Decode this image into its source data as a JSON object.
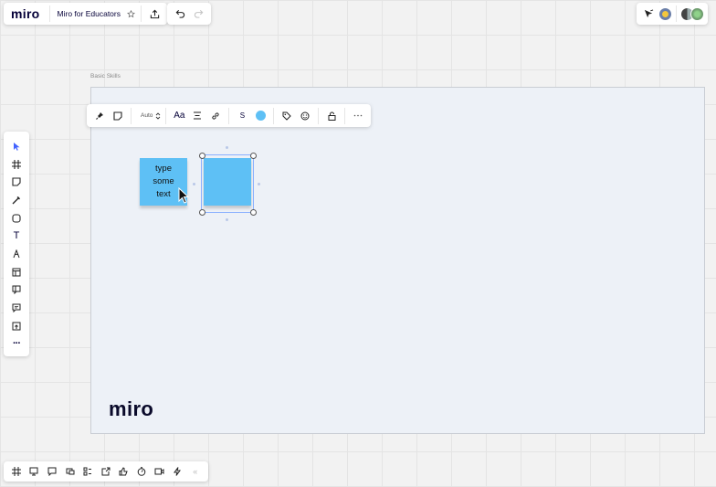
{
  "topbar": {
    "logo": "miro",
    "board_title": "Miro for Educators",
    "star_icon": "star-icon",
    "share_icon": "upload-icon"
  },
  "undo_redo": {
    "undo_icon": "undo-icon",
    "redo_icon": "redo-icon"
  },
  "right_panel": {
    "icons": [
      "cursor-share-icon",
      "avatar",
      "avatar",
      "avatar"
    ]
  },
  "frame": {
    "label": "Basic Skills",
    "logo_text": "miro",
    "background": "#edf1f7"
  },
  "context_toolbar": {
    "font_size_value": "Auto",
    "font_label": "Aa",
    "size_label": "S",
    "sticky_color": "#5ec0f5",
    "icons": [
      "pin-icon",
      "sticky-note-icon",
      "stepper-icon",
      "font-icon",
      "align-icon",
      "link-icon",
      "color-swatch-icon",
      "tag-icon",
      "emoji-icon",
      "lock-icon",
      "more-icon"
    ]
  },
  "sticky_notes": [
    {
      "text": "type some text",
      "color": "#5ec0f5"
    },
    {
      "text": "",
      "color": "#5ec0f5",
      "selected": true
    }
  ],
  "left_toolbar": {
    "tools": [
      "select-icon",
      "frame-icon",
      "sticky-note-icon",
      "pen-icon",
      "shape-icon",
      "text-icon",
      "draw-icon",
      "template-icon",
      "card-icon",
      "comment-icon",
      "upload-icon",
      "more-icon"
    ],
    "text_tool_label": "T",
    "more_label": "···"
  },
  "bottom_toolbar": {
    "tools": [
      "frames-icon",
      "presentation-icon",
      "comments-icon",
      "screen-share-icon",
      "kanban-icon",
      "embed-icon",
      "voting-icon",
      "timer-icon",
      "video-icon",
      "lightning-icon",
      "collapse-icon"
    ],
    "collapse_label": "«"
  },
  "colors": {
    "accent": "#4262ff",
    "sticky": "#5ec0f5",
    "canvas": "#f2f2f2"
  }
}
